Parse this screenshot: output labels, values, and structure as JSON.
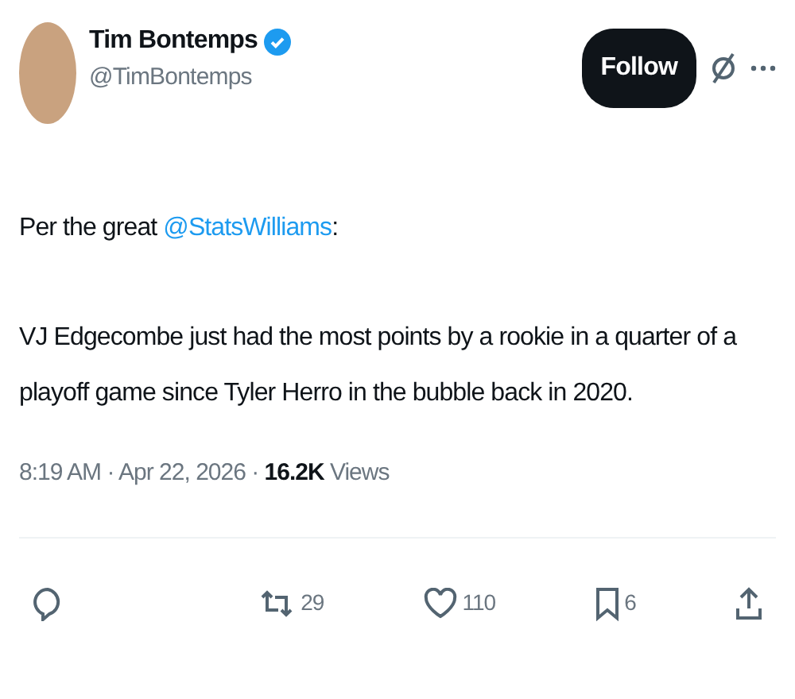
{
  "author": {
    "name": "Tim Bontemps",
    "verified": true,
    "handle": "@TimBontemps"
  },
  "follow_button": "Follow",
  "intro": [
    {
      "kind": "text",
      "text": "Per the great "
    },
    {
      "kind": "mention",
      "text": "@StatsWilliams"
    },
    {
      "kind": "text",
      "text": ":"
    }
  ],
  "body": "VJ Edgecombe just had the most points by a rookie in a quarter of a playoff game since Tyler Herro in the bubble back in 2020.",
  "meta": "8:19 AM · Apr 22, 2026 · **16.2K** Views",
  "actions": [
    {
      "kind": "reply"
    },
    {
      "kind": "repost",
      "count": "29"
    },
    {
      "kind": "like",
      "count": "110"
    },
    {
      "kind": "bookmark",
      "count": "6"
    },
    {
      "kind": "share"
    }
  ]
}
